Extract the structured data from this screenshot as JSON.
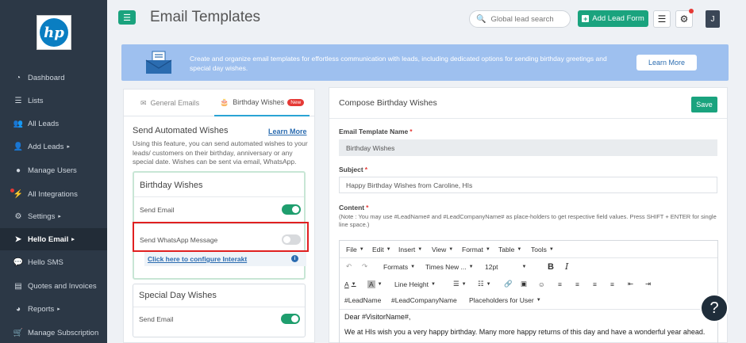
{
  "sidebar": {
    "logo_text": "hp",
    "items": [
      {
        "label": "Dashboard",
        "icon": "dashboard-icon"
      },
      {
        "label": "Lists",
        "icon": "list-icon"
      },
      {
        "label": "All Leads",
        "icon": "users-icon"
      },
      {
        "label": "Add Leads",
        "icon": "add-user-icon"
      },
      {
        "label": "Manage Users",
        "icon": "user-circle-icon"
      },
      {
        "label": "All Integrations",
        "icon": "plug-icon"
      },
      {
        "label": "Settings",
        "icon": "gear-icon"
      },
      {
        "label": "Hello Email",
        "icon": "send-icon"
      },
      {
        "label": "Hello SMS",
        "icon": "chat-icon"
      },
      {
        "label": "Quotes and Invoices",
        "icon": "file-icon"
      },
      {
        "label": "Reports",
        "icon": "pie-chart-icon"
      },
      {
        "label": "Manage Subscription",
        "icon": "cart-icon"
      }
    ]
  },
  "header": {
    "title": "Email Templates",
    "search_placeholder": "Global lead search",
    "add_lead_label": "Add Lead Form",
    "avatar_initial": "J"
  },
  "banner": {
    "text": "Create and organize email templates for effortless communication with leads, including dedicated options for sending birthday greetings and special day wishes.",
    "button": "Learn More"
  },
  "left": {
    "tabs": [
      {
        "label": "General Emails"
      },
      {
        "label": "Birthday Wishes",
        "badge": "New"
      }
    ],
    "section_title": "Send Automated Wishes",
    "learn_more": "Learn More",
    "description": "Using this feature, you can send automated wishes to your leads/ customers on their birthday, anniversary or any special date. Wishes can be sent via email, WhatsApp.",
    "birthday_card": {
      "title": "Birthday Wishes",
      "send_email": "Send Email",
      "send_email_on": true,
      "send_whatsapp": "Send WhatsApp Message",
      "send_whatsapp_on": false,
      "configure_link": "Click here to configure Interakt"
    },
    "special_card": {
      "title": "Special Day Wishes",
      "send_email": "Send Email",
      "send_email_on": true
    }
  },
  "compose": {
    "title": "Compose Birthday Wishes",
    "save": "Save",
    "template_name_label": "Email Template Name",
    "template_name_value": "Birthday Wishes",
    "subject_label": "Subject",
    "subject_value": "Happy Birthday Wishes from  Caroline, HIs",
    "content_label": "Content",
    "note": "(Note : You may use #LeadName# and #LeadCompanyName# as place-holders to get respective field values. Press SHIFT + ENTER for single line space.)",
    "menu": [
      "File",
      "Edit",
      "Insert",
      "View",
      "Format",
      "Table",
      "Tools"
    ],
    "formats": "Formats",
    "font": "Times New ...",
    "size": "12pt",
    "line_height": "Line Height",
    "placeholders": [
      "#LeadName",
      "#LeadCompanyName",
      "Placeholders for User"
    ],
    "body_line1": "Dear #VisitorName#,",
    "body_line2": "We at HIs wish you a very happy birthday. Many more happy returns of this day and have a wonderful year ahead."
  },
  "help": "?"
}
